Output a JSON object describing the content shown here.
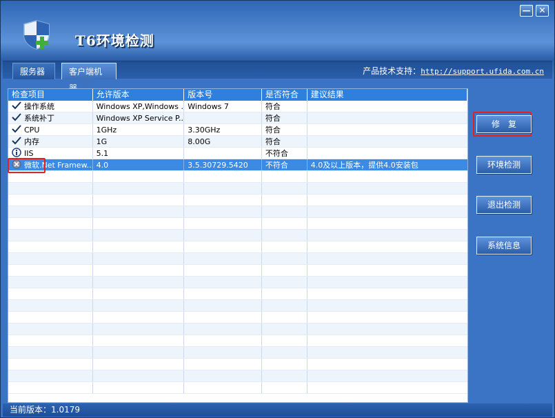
{
  "window": {
    "title": "T6环境检测",
    "minimize_label": "—",
    "close_label": "✕"
  },
  "tabs": [
    {
      "label": "服务器"
    },
    {
      "label": "客户端机器"
    }
  ],
  "support": {
    "label": "产品技术支持：",
    "url": "http://support.ufida.com.cn"
  },
  "table": {
    "headers": [
      "检查项目",
      "允许版本",
      "版本号",
      "是否符合",
      "建议结果"
    ],
    "rows": [
      {
        "status_icon": "check-icon",
        "item": "操作系统",
        "allowed": "Windows XP,Windows ...",
        "version": "Windows 7",
        "match": "符合",
        "advice": ""
      },
      {
        "status_icon": "check-icon",
        "item": "系统补丁",
        "allowed": "Windows XP Service P...",
        "version": "",
        "match": "符合",
        "advice": ""
      },
      {
        "status_icon": "check-icon",
        "item": "CPU",
        "allowed": "1GHz",
        "version": "3.30GHz",
        "match": "符合",
        "advice": ""
      },
      {
        "status_icon": "check-icon",
        "item": "内存",
        "allowed": "1G",
        "version": "8.00G",
        "match": "符合",
        "advice": ""
      },
      {
        "status_icon": "info-icon",
        "item": "IIS",
        "allowed": "5.1",
        "version": "",
        "match": "不符合",
        "advice": ""
      },
      {
        "status_icon": "error-icon",
        "item": "微软.Net Framew...",
        "allowed": "4.0",
        "version": "3.5.30729.5420",
        "match": "不符合",
        "advice": "4.0及以上版本，提供4.0安装包"
      }
    ]
  },
  "buttons": {
    "fix": "修　复",
    "env_check": "环境检测",
    "exit_check": "退出检测",
    "sys_info": "系统信息"
  },
  "status": {
    "version_label": "当前版本：",
    "version": "1.0179"
  },
  "colors": {
    "selected_row": "#3a8ae6",
    "highlight": "#e8201c",
    "header": "#2f7fdd"
  }
}
